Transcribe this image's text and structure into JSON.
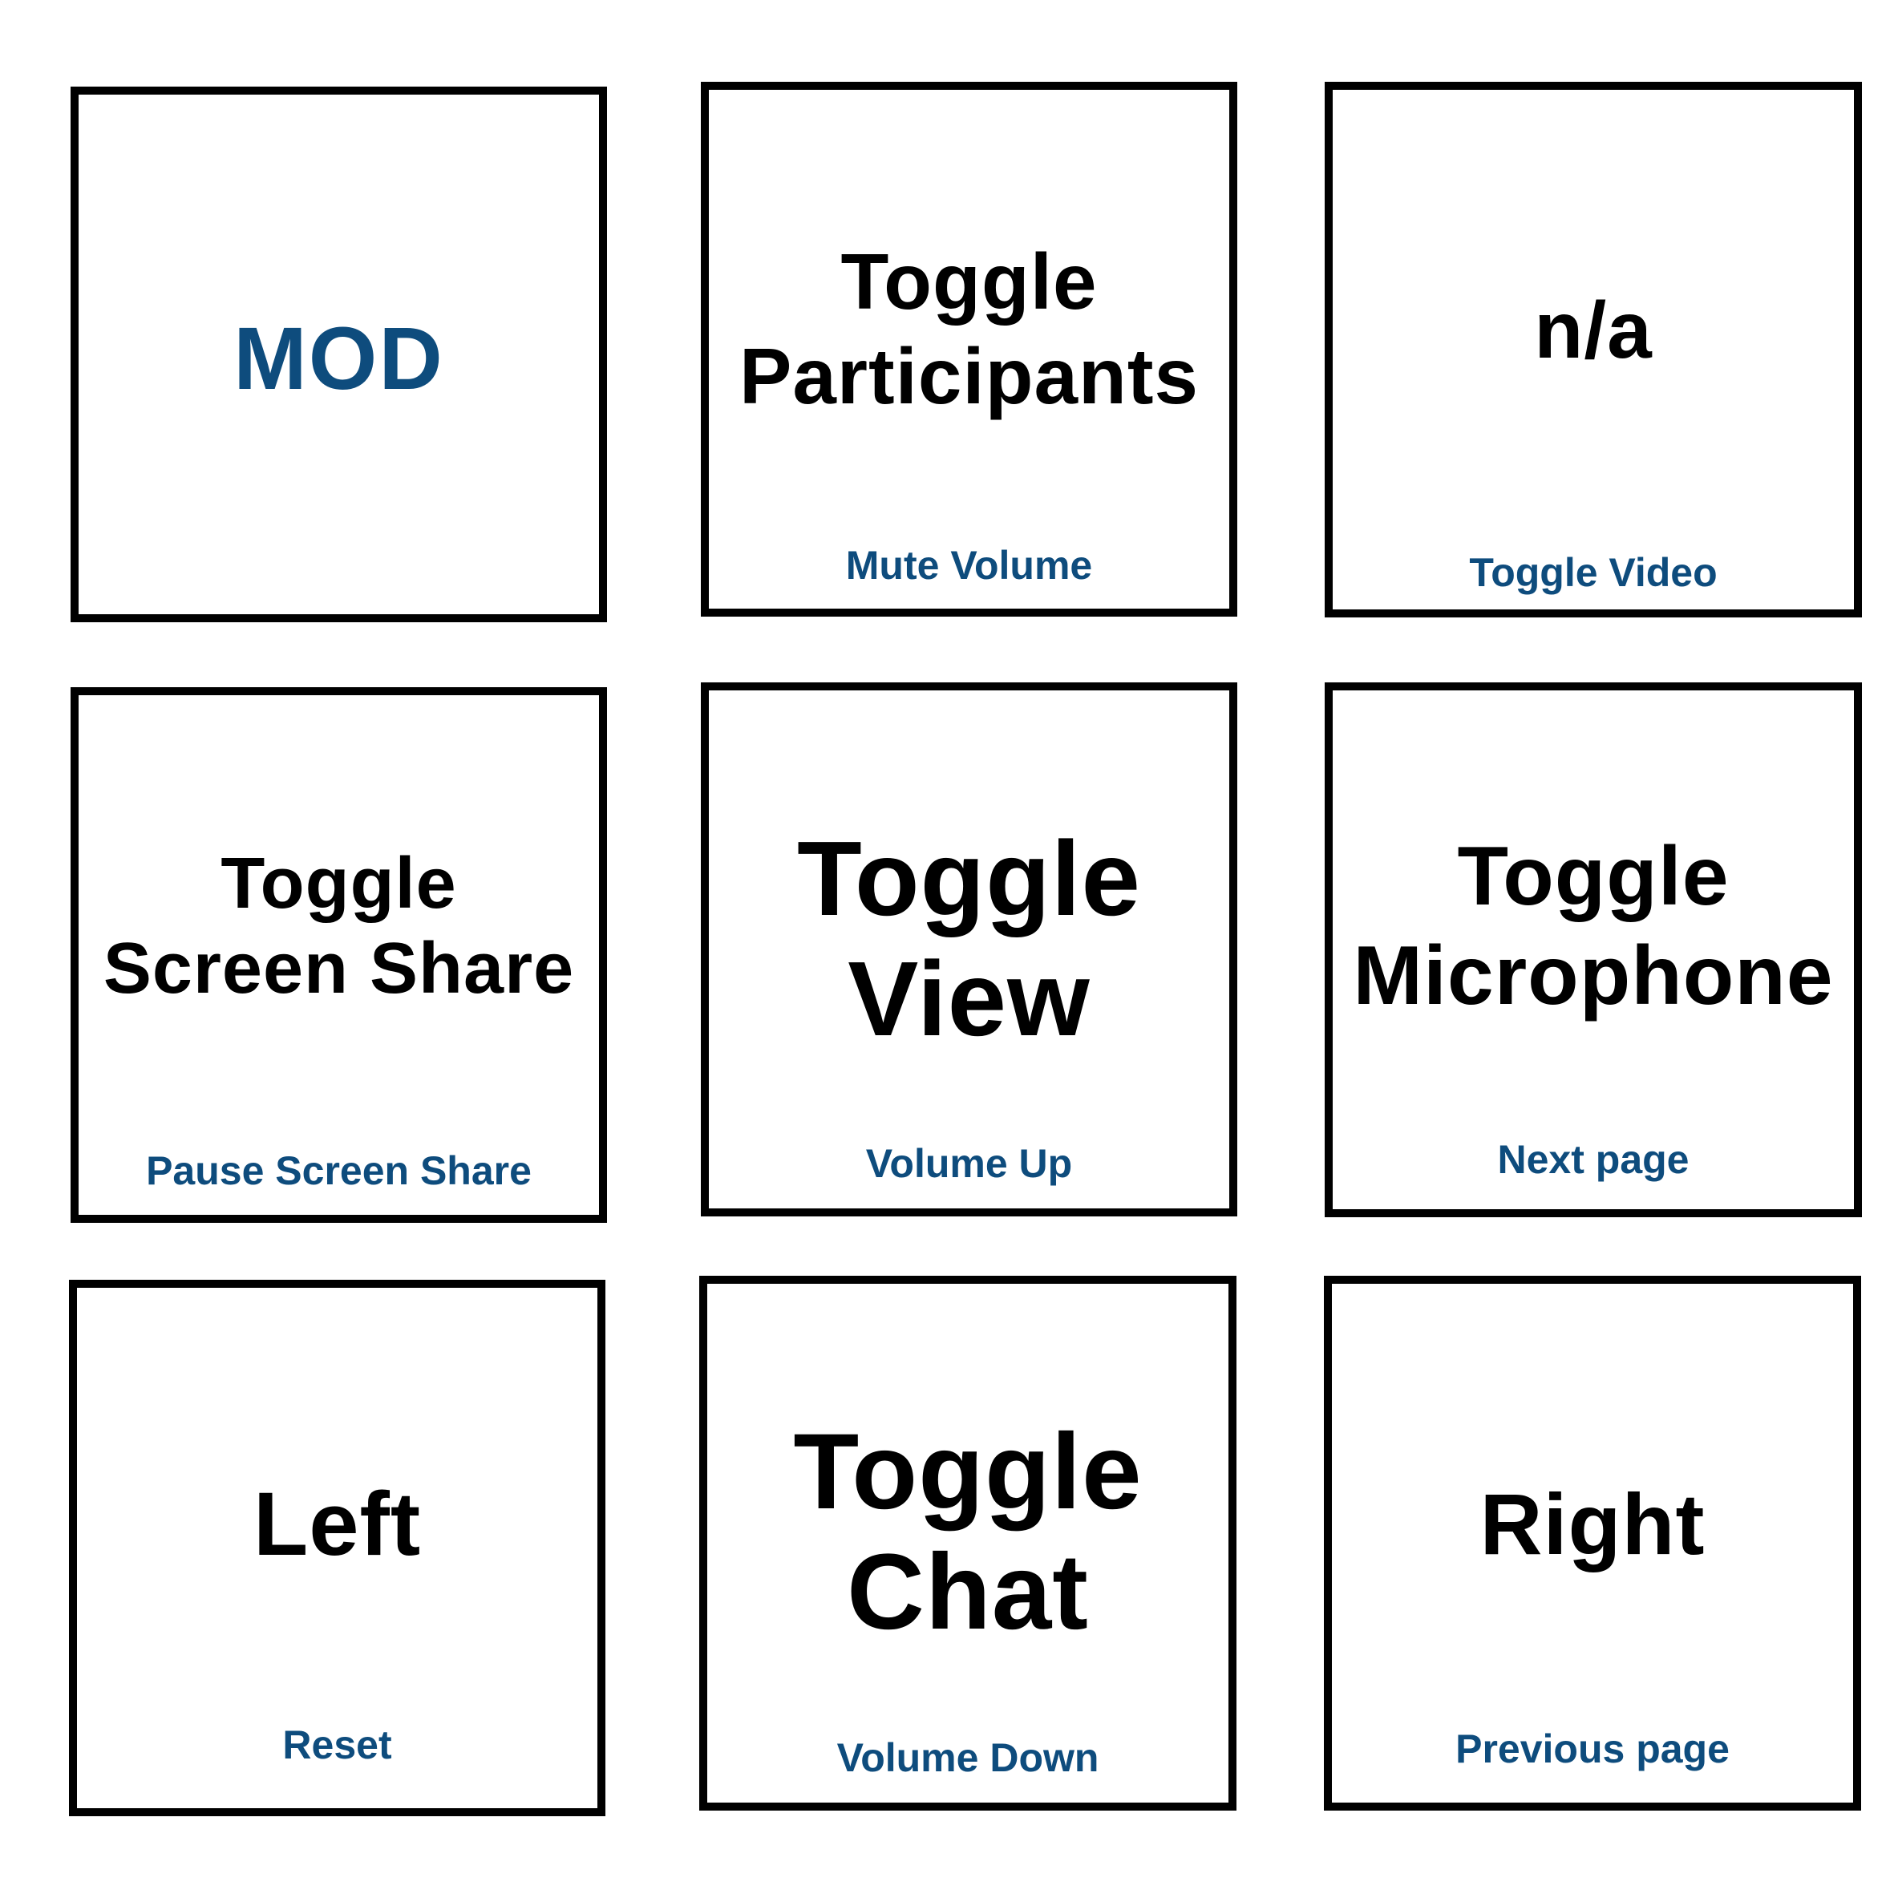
{
  "colors": {
    "border": "#000000",
    "primary_text": "#000000",
    "accent": "#0e4c7d",
    "background": "#ffffff"
  },
  "keys": [
    {
      "primary": [
        "MOD"
      ],
      "secondary": ""
    },
    {
      "primary": [
        "Toggle",
        "Participants"
      ],
      "secondary": "Mute Volume"
    },
    {
      "primary": [
        "n/a"
      ],
      "secondary": "Toggle Video"
    },
    {
      "primary": [
        "Toggle",
        "Screen Share"
      ],
      "secondary": "Pause Screen Share"
    },
    {
      "primary": [
        "Toggle",
        "View"
      ],
      "secondary": "Volume Up"
    },
    {
      "primary": [
        "Toggle",
        "Microphone"
      ],
      "secondary": "Next page"
    },
    {
      "primary": [
        "Left"
      ],
      "secondary": "Reset"
    },
    {
      "primary": [
        "Toggle",
        "Chat"
      ],
      "secondary": "Volume Down"
    },
    {
      "primary": [
        "Right"
      ],
      "secondary": "Previous page"
    }
  ]
}
